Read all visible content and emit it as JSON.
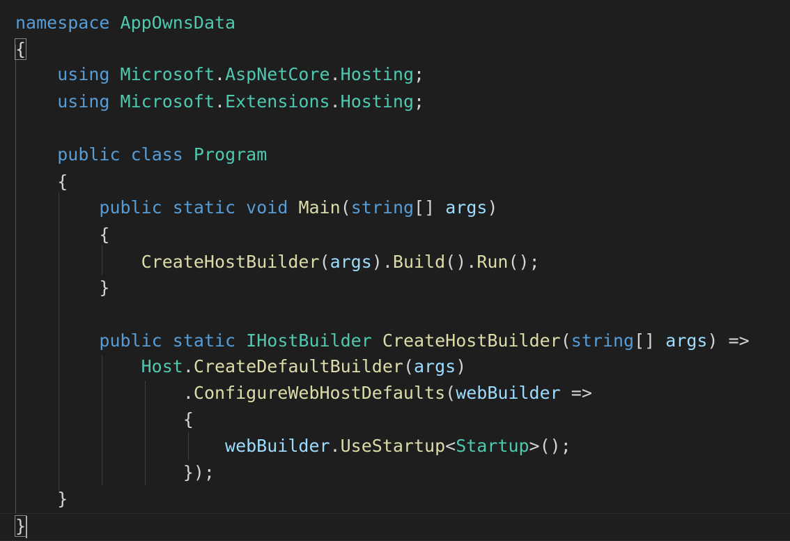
{
  "colors": {
    "background": "#1e1e1e",
    "keyword": "#569cd6",
    "control_keyword": "#c586c0",
    "type": "#4ec9b0",
    "function": "#dcdcaa",
    "variable": "#9cdcfe",
    "punctuation": "#d4d4d4"
  },
  "code": {
    "l1": {
      "kw": "namespace",
      "name": "AppOwnsData"
    },
    "l2": {
      "brace": "{"
    },
    "l3": {
      "kw": "using",
      "ns1": "Microsoft",
      "dot": ".",
      "ns2": "AspNetCore",
      "ns3": "Hosting",
      "end": ";"
    },
    "l4": {
      "kw": "using",
      "ns1": "Microsoft",
      "ns2": "Extensions",
      "ns3": "Hosting",
      "end": ";"
    },
    "l6": {
      "kw1": "public",
      "kw2": "class",
      "name": "Program"
    },
    "l7": {
      "brace": "{"
    },
    "l8": {
      "kw1": "public",
      "kw2": "static",
      "kw3": "void",
      "fn": "Main",
      "open": "(",
      "kw4": "string",
      "arr": "[]",
      "arg": "args",
      "close": ")"
    },
    "l9": {
      "brace": "{"
    },
    "l10": {
      "fn1": "CreateHostBuilder",
      "p1": "(",
      "arg": "args",
      "p2": ").",
      "fn2": "Build",
      "p3": "().",
      "fn3": "Run",
      "p4": "();"
    },
    "l11": {
      "brace": "}"
    },
    "l13": {
      "kw1": "public",
      "kw2": "static",
      "type": "IHostBuilder",
      "fn": "CreateHostBuilder",
      "open": "(",
      "kw3": "string",
      "arr": "[]",
      "arg": "args",
      "close": ")",
      "arrow": "=>"
    },
    "l14": {
      "type": "Host",
      "dot": ".",
      "fn": "CreateDefaultBuilder",
      "open": "(",
      "arg": "args",
      "close": ")"
    },
    "l15": {
      "dot": ".",
      "fn": "ConfigureWebHostDefaults",
      "open": "(",
      "arg": "webBuilder",
      "arrow": "=>"
    },
    "l16": {
      "brace": "{"
    },
    "l17": {
      "var": "webBuilder",
      "dot": ".",
      "fn": "UseStartup",
      "lt": "<",
      "type": "Startup",
      "gt": ">",
      "end": "();"
    },
    "l18": {
      "end": "});"
    },
    "l19": {
      "brace": "}"
    },
    "l20": {
      "brace": "}"
    }
  }
}
